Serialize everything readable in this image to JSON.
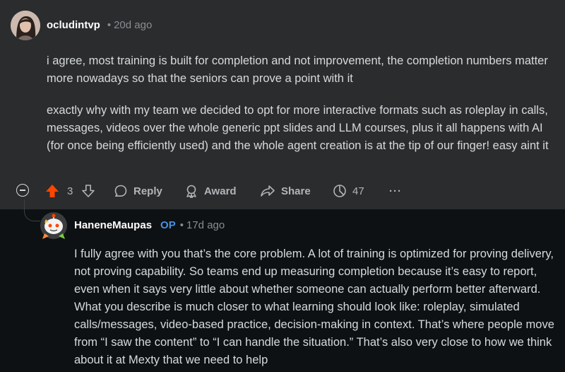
{
  "comment1": {
    "author": "ocludintvp",
    "time": "20d ago",
    "paragraphs": [
      "i agree, most training is built for completion and not improvement, the completion numbers matter more nowadays so that the seniors can prove a point with it",
      "exactly why with my team we decided to opt for more interactive formats such as roleplay in calls, messages, videos over the whole generic ppt slides and LLM courses, plus it all happens with AI (for once being efficiently used) and the whole agent creation is at the tip of our finger! easy aint it"
    ],
    "votes": "3",
    "reply_label": "Reply",
    "award_label": "Award",
    "share_label": "Share",
    "views": "47",
    "more": "···"
  },
  "comment2": {
    "author": "HaneneMaupas",
    "op_badge": "OP",
    "time": "17d ago",
    "paragraph": "I fully agree with you that’s the core problem. A lot of training is optimized for proving delivery, not proving capability. So teams end up measuring completion because it’s easy to report, even when it says very little about whether someone can actually perform better afterward. What you describe is much closer to what learning should look like: roleplay, simulated calls/messages, video-based practice, decision-making in context. That’s where people move from “I saw the content” to “I can handle the situation.” That’s also very close to how we think about it at Mexty that we need to help"
  },
  "colors": {
    "background": "#0e1113",
    "card": "#2a2c2e",
    "upvote": "#ff4500",
    "op": "#4a90e2"
  }
}
